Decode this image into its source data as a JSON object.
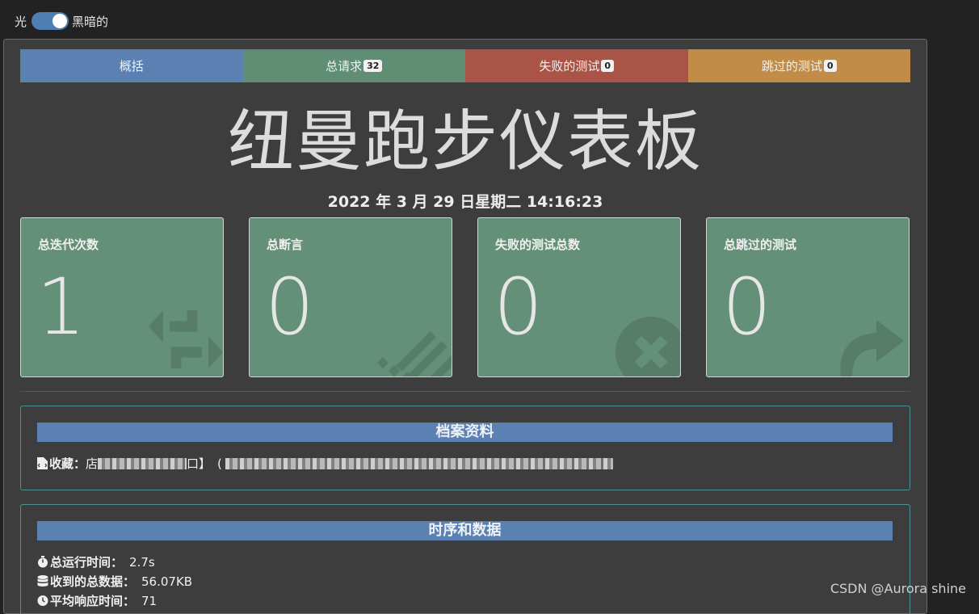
{
  "theme_toggle": {
    "light_label": "光",
    "dark_label": "黑暗的",
    "state": "dark"
  },
  "tabs": [
    {
      "label": "概括",
      "color": "#5b80b2"
    },
    {
      "label": "总请求",
      "badge": "32",
      "color": "#5f8e75"
    },
    {
      "label": "失败的测试",
      "badge": "0",
      "color": "#a95446"
    },
    {
      "label": "跳过的测试",
      "badge": "0",
      "color": "#c08c47"
    }
  ],
  "title": "纽曼跑步仪表板",
  "date": "2022 年 3 月 29 日星期二 14:16:23",
  "stats": [
    {
      "label": "总迭代次数",
      "value": "1",
      "icon": "repeat-icon"
    },
    {
      "label": "总断言",
      "value": "0",
      "icon": "list-icon"
    },
    {
      "label": "失败的测试总数",
      "value": "0",
      "icon": "times-circle-icon"
    },
    {
      "label": "总跳过的测试",
      "value": "0",
      "icon": "share-arrow-icon"
    }
  ],
  "profile": {
    "heading": "档案资料",
    "collection_label": "收藏：",
    "collection_value_visible": "店",
    "collection_fragment_1": "口】",
    "collection_fragment_2": "("
  },
  "timings": {
    "heading": "时序和数据",
    "rows": [
      {
        "icon": "stopwatch-icon",
        "label": "总运行时间：",
        "value": "2.7s"
      },
      {
        "icon": "database-icon",
        "label": "收到的总数据：",
        "value": "56.07KB"
      },
      {
        "icon": "clock-icon",
        "label": "平均响应时间：",
        "value": "71"
      }
    ]
  },
  "watermark": "CSDN @Aurora shine",
  "colors": {
    "page_bg": "#222222",
    "panel_bg": "#3d3d3d",
    "card_green": "#648f78",
    "heading_blue": "#5b80b2"
  }
}
